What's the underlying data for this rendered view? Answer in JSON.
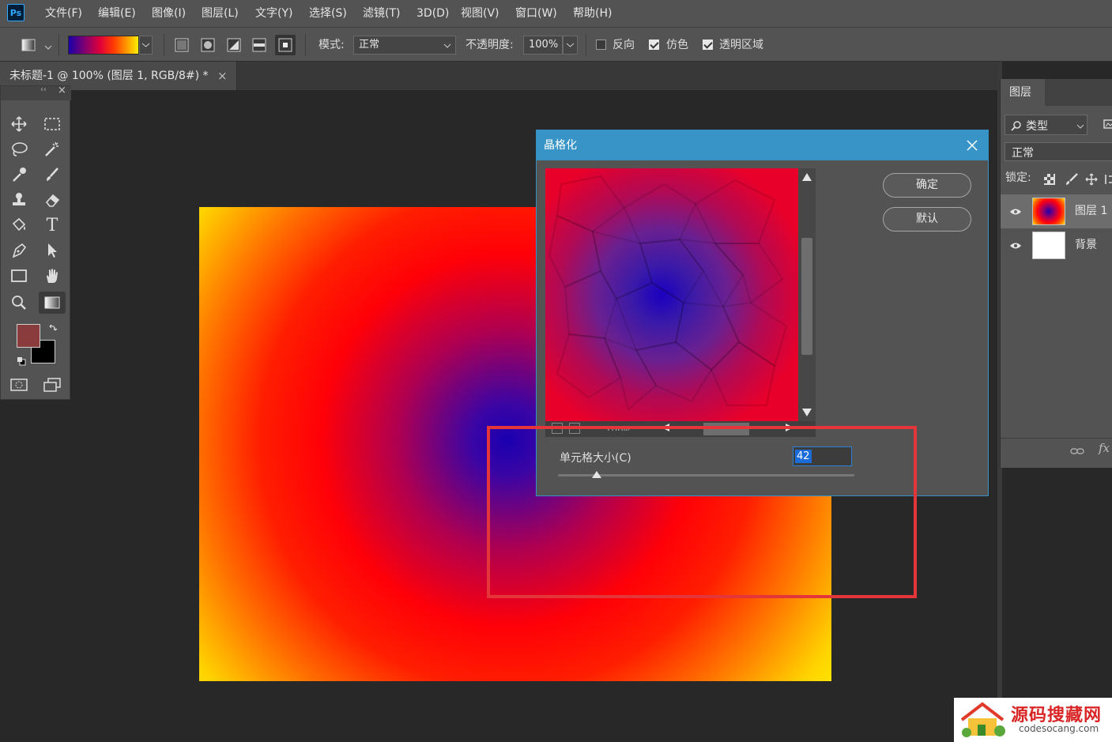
{
  "app": {
    "logo": "Ps"
  },
  "menu": [
    "文件(F)",
    "编辑(E)",
    "图像(I)",
    "图层(L)",
    "文字(Y)",
    "选择(S)",
    "滤镜(T)",
    "3D(D)",
    "视图(V)",
    "窗口(W)",
    "帮助(H)"
  ],
  "options": {
    "mode_label": "模式:",
    "mode_value": "正常",
    "opacity_label": "不透明度:",
    "opacity_value": "100%",
    "reverse_label": "反向",
    "reverse_checked": false,
    "dither_label": "仿色",
    "dither_checked": true,
    "transparency_label": "透明区域",
    "transparency_checked": true,
    "gradient_colors": [
      "#1a00a8",
      "#e0003a",
      "#ff3c00",
      "#ffee00"
    ]
  },
  "document": {
    "tab_title": "未标题-1 @ 100% (图层 1, RGB/8#) *",
    "close_glyph": "×"
  },
  "tools": {
    "foreground_color": "#8a3c3c",
    "background_color": "#000000",
    "items": [
      "move-icon",
      "marquee-icon",
      "lasso-icon",
      "magic-wand-icon",
      "eyedropper-icon",
      "brush-icon",
      "stamp-icon",
      "eraser-icon",
      "paint-bucket-icon",
      "type-icon",
      "pen-icon",
      "path-select-icon",
      "rectangle-icon",
      "hand-icon",
      "zoom-icon",
      "gradient-icon"
    ],
    "type_glyph": "T"
  },
  "layers_panel": {
    "tab": "图层",
    "filter_label": "类型",
    "blend_mode": "正常",
    "lock_label": "锁定:",
    "layers": [
      {
        "name": "图层 1",
        "selected": true
      },
      {
        "name": "背景",
        "selected": false
      }
    ],
    "fx_label": "fx"
  },
  "dialog": {
    "title": "晶格化",
    "ok_label": "确定",
    "default_label": "默认",
    "zoom_value": "100%",
    "cell_size_label": "单元格大小(C)",
    "cell_size_value": "42",
    "slider_fraction": 0.13,
    "close_glyph": "×"
  },
  "watermark": {
    "text": "源码搜藏网",
    "url": "codesocang.com"
  },
  "highlight_color": "#e4363a"
}
